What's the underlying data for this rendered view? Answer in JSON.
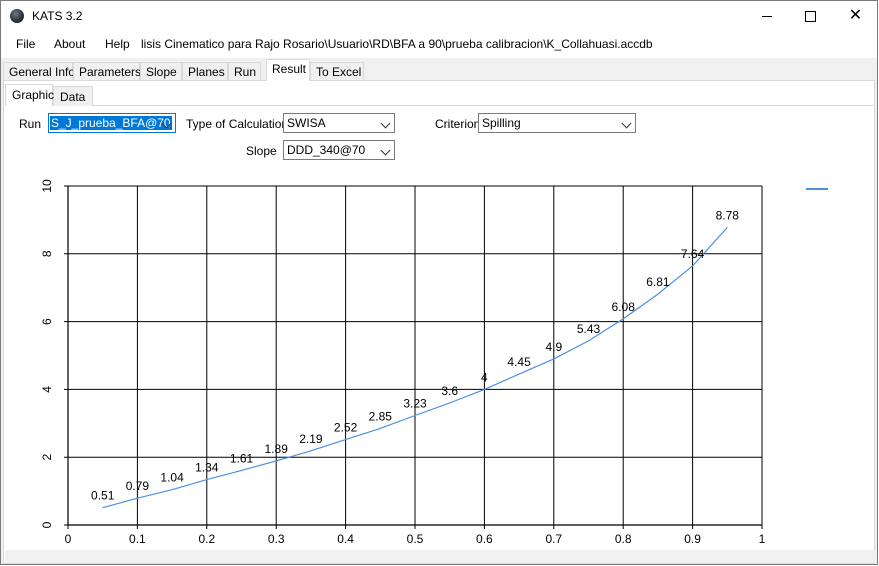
{
  "window": {
    "title": "KATS 3.2",
    "controls": {
      "minimize": "minimize",
      "maximize": "maximize",
      "close": "close"
    }
  },
  "menu": {
    "items": [
      "File",
      "About",
      "Help"
    ],
    "path": "lisis Cinematico para Rajo Rosario\\Usuario\\RD\\BFA a 90\\prueba calibracion\\K_Collahuasi.accdb"
  },
  "tabs": [
    "General Info",
    "Parameters",
    "Slope",
    "Planes",
    "Run",
    "Result",
    "To Excel"
  ],
  "active_tab": "Result",
  "subtabs": [
    "Graphic",
    "Data"
  ],
  "active_subtab": "Graphic",
  "controls": {
    "run_label": "Run",
    "run_value": "S_J_prueba_BFA@70",
    "type_label": "Type of Calculation",
    "type_value": "SWISA",
    "criterion_label": "Criterion",
    "criterion_value": "Spilling",
    "slope_label": "Slope",
    "slope_value": "DDD_340@70"
  },
  "colors": {
    "series": "#4a90e2",
    "grid": "#000000",
    "selection": "#0078d7"
  },
  "chart_data": {
    "type": "line",
    "title": "",
    "xlabel": "",
    "ylabel": "",
    "xlim": [
      0,
      1
    ],
    "ylim": [
      0,
      10
    ],
    "x_ticks": [
      "0",
      "0.1",
      "0.2",
      "0.3",
      "0.4",
      "0.5",
      "0.6",
      "0.7",
      "0.8",
      "0.9",
      "1"
    ],
    "y_ticks": [
      "0",
      "2",
      "4",
      "6",
      "8",
      "10"
    ],
    "grid": true,
    "legend": "top-right",
    "series": [
      {
        "x": [
          0.05,
          0.1,
          0.15,
          0.2,
          0.25,
          0.3,
          0.35,
          0.4,
          0.45,
          0.5,
          0.55,
          0.6,
          0.65,
          0.7,
          0.75,
          0.8,
          0.85,
          0.9,
          0.95
        ],
        "y": [
          0.51,
          0.79,
          1.04,
          1.34,
          1.61,
          1.89,
          2.19,
          2.52,
          2.85,
          3.23,
          3.6,
          4,
          4.45,
          4.9,
          5.43,
          6.08,
          6.81,
          7.64,
          8.78
        ],
        "labels": [
          "0.51",
          "0.79",
          "1.04",
          "1.34",
          "1.61",
          "1.89",
          "2.19",
          "2.52",
          "2.85",
          "3.23",
          "3.6",
          "4",
          "4.45",
          "4.9",
          "5.43",
          "6.08",
          "6.81",
          "7.64",
          "8.78"
        ]
      }
    ]
  }
}
